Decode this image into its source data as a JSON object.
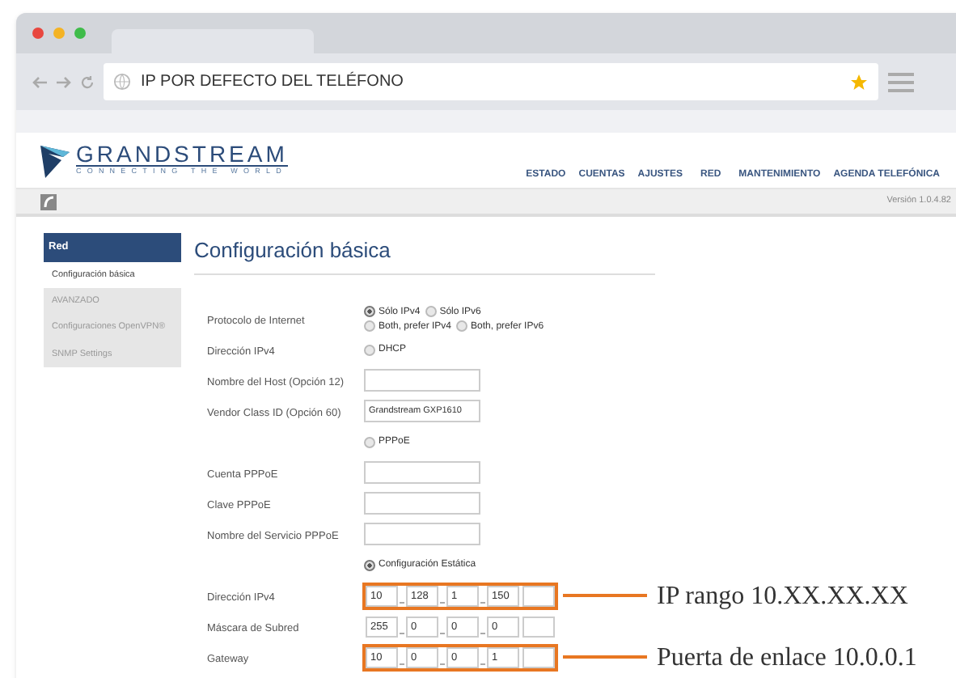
{
  "browser": {
    "address": "IP POR DEFECTO DEL TELÉFONO"
  },
  "header": {
    "logo_name": "GRANDSTREAM",
    "logo_tagline": "CONNECTING THE WORLD",
    "nav": [
      {
        "label": "ESTADO"
      },
      {
        "label": "CUENTAS"
      },
      {
        "label": "AJUSTES"
      },
      {
        "label": "RED"
      },
      {
        "label": "MANTENIMIENTO"
      },
      {
        "label": "AGENDA TELEFÓNICA"
      }
    ],
    "version": "Versión 1.0.4.82"
  },
  "sidebar": {
    "heading": "Red",
    "items": [
      {
        "label": "Configuración básica",
        "selected": true
      },
      {
        "label": "AVANZADO",
        "selected": false
      },
      {
        "label": "Configuraciones OpenVPN®",
        "selected": false
      },
      {
        "label": "SNMP Settings",
        "selected": false
      }
    ]
  },
  "page_title": "Configuración básica",
  "form": [
    {
      "kind": "radios",
      "label": "Protocolo de Internet",
      "lines": [
        [
          {
            "label": "Sólo IPv4",
            "selected": true
          },
          {
            "label": "Sólo IPv6",
            "selected": false
          }
        ],
        [
          {
            "label": "Both, prefer IPv4",
            "selected": false
          },
          {
            "label": "Both, prefer IPv6",
            "selected": false
          }
        ]
      ]
    },
    {
      "kind": "radios",
      "label": "Dirección IPv4",
      "lines": [
        [
          {
            "label": "DHCP",
            "selected": false
          }
        ]
      ]
    },
    {
      "kind": "text",
      "label": "Nombre del Host (Opción 12)"
    },
    {
      "kind": "text",
      "label": "Vendor Class ID (Opción 60)",
      "value": "Grandstream GXP1610"
    },
    {
      "kind": "radios",
      "lines": [
        [
          {
            "label": "PPPoE",
            "selected": false
          }
        ]
      ]
    },
    {
      "kind": "text",
      "label": "Cuenta PPPoE"
    },
    {
      "kind": "text",
      "label": "Clave PPPoE"
    },
    {
      "kind": "text",
      "label": "Nombre del Servicio PPPoE"
    },
    {
      "kind": "radios",
      "lines": [
        [
          {
            "label": "Configuración Estática",
            "selected": true
          }
        ]
      ]
    },
    {
      "kind": "ip",
      "label": "Dirección IPv4",
      "octets": [
        "10",
        "128",
        "1",
        "150"
      ],
      "highlighted": true,
      "annotation": "IP rango 10.XX.XX.XX"
    },
    {
      "kind": "ip",
      "label": "Máscara de Subred",
      "octets": [
        "255",
        "0",
        "0",
        "0"
      ],
      "highlighted": false
    },
    {
      "kind": "ip",
      "label": "Gateway",
      "octets": [
        "10",
        "0",
        "0",
        "1"
      ],
      "highlighted": true,
      "annotation": "Puerta de enlace 10.0.0.1"
    }
  ]
}
